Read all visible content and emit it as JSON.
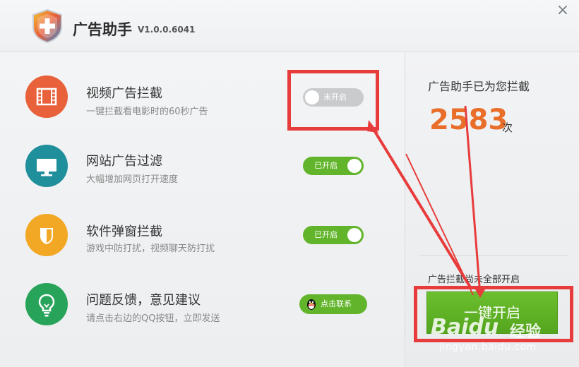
{
  "app": {
    "title": "广告助手",
    "version": "V1.0.0.6041",
    "close_icon": "×"
  },
  "features": [
    {
      "title": "视频广告拦截",
      "desc": "一键拦截看电影时的60秒广告",
      "icon": "film-icon",
      "color": "#e8613a",
      "toggle_label": "未开启",
      "enabled": false
    },
    {
      "title": "网站广告过滤",
      "desc": "大幅增加网页打开速度",
      "icon": "monitor-icon",
      "color": "#1f8f9c",
      "toggle_label": "已开启",
      "enabled": true
    },
    {
      "title": "软件弹窗拦截",
      "desc": "游戏中防打扰，视频聊天防打扰",
      "icon": "shield-icon",
      "color": "#f2a825",
      "toggle_label": "已开启",
      "enabled": true
    },
    {
      "title": "问题反馈，意见建议",
      "desc": "请点击右边的QQ按钮，立即发送",
      "icon": "lightbulb-icon",
      "color": "#28a35a",
      "button_label": "点击联系"
    }
  ],
  "stats": {
    "label": "广告助手已为您拦截",
    "count": "2583",
    "unit": "次"
  },
  "status": {
    "warning": "广告拦截尚未全部开启",
    "onekey_label": "一键开启"
  },
  "colors": {
    "accent_green": "#62b52b",
    "count_orange": "#e86e2a",
    "annotation_red": "#e83c3c"
  },
  "watermark": {
    "brand": "Baidu",
    "product": "经验",
    "url": "jingyan.baidu.com"
  }
}
